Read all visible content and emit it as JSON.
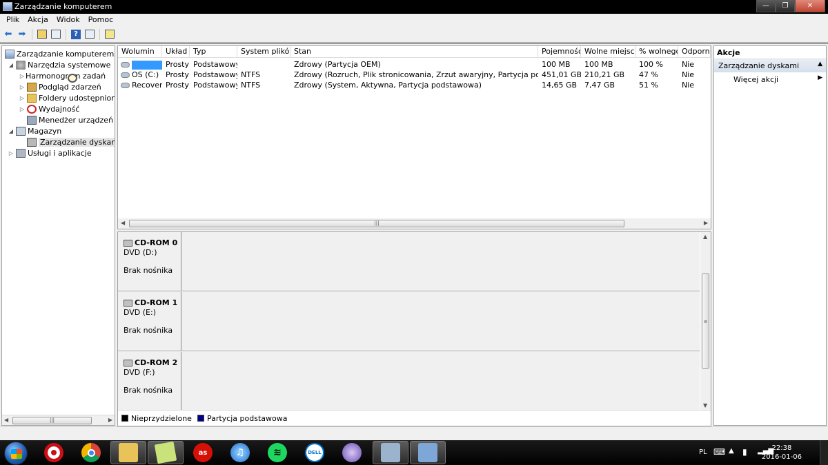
{
  "window": {
    "title": "Zarządzanie komputerem"
  },
  "menu": [
    "Plik",
    "Akcja",
    "Widok",
    "Pomoc"
  ],
  "tree": {
    "root": "Zarządzanie komputerem (lokal",
    "system_tools": "Narzędzia systemowe",
    "task_scheduler": "Harmonogram zadań",
    "event_viewer": "Podgląd zdarzeń",
    "shared_folders": "Foldery udostępnione",
    "performance": "Wydajność",
    "device_manager": "Menedżer urządzeń",
    "storage": "Magazyn",
    "disk_management": "Zarządzanie dyskami",
    "services_apps": "Usługi i aplikacje"
  },
  "volume_table": {
    "columns": [
      "Wolumin",
      "Układ",
      "Typ",
      "System plików",
      "Stan",
      "Pojemność",
      "Wolne miejsce",
      "% wolnego",
      "Odporno"
    ],
    "rows": [
      {
        "volume": "",
        "layout": "Prosty",
        "type": "Podstawowy",
        "fs": "",
        "status": "Zdrowy (Partycja OEM)",
        "capacity": "100 MB",
        "free": "100 MB",
        "pct": "100 %",
        "fault": "Nie"
      },
      {
        "volume": "OS (C:)",
        "layout": "Prosty",
        "type": "Podstawowy",
        "fs": "NTFS",
        "status": "Zdrowy (Rozruch, Plik stronicowania, Zrzut awaryjny, Partycja podstawowa)",
        "capacity": "451,01 GB",
        "free": "210,21 GB",
        "pct": "47 %",
        "fault": "Nie"
      },
      {
        "volume": "Recovery",
        "layout": "Prosty",
        "type": "Podstawowy",
        "fs": "NTFS",
        "status": "Zdrowy (System, Aktywna, Partycja podstawowa)",
        "capacity": "14,65 GB",
        "free": "7,47 GB",
        "pct": "51 %",
        "fault": "Nie"
      }
    ]
  },
  "disks": [
    {
      "name": "CD-ROM 0",
      "type": "DVD (D:)",
      "status": "Brak nośnika"
    },
    {
      "name": "CD-ROM 1",
      "type": "DVD (E:)",
      "status": "Brak nośnika"
    },
    {
      "name": "CD-ROM 2",
      "type": "DVD (F:)",
      "status": "Brak nośnika"
    }
  ],
  "legend": [
    {
      "label": "Nieprzydzielone",
      "color": "#000000"
    },
    {
      "label": "Partycja podstawowa",
      "color": "#00008b"
    }
  ],
  "actions": {
    "header": "Akcje",
    "group": "Zarządzanie dyskami",
    "more": "Więcej akcji"
  },
  "taskbar": {
    "apps": [
      "opera",
      "chrome",
      "explorer",
      "notes",
      "lastfm",
      "itunes",
      "spotify",
      "dell",
      "torrent",
      "remote",
      "computer-management"
    ],
    "lastfm_label": "as",
    "dell_label": "DELL",
    "language": "PL",
    "time": "22:38",
    "date": "2016-01-06"
  },
  "colors": {
    "selection": "#3399ff",
    "titlebar": "#000000",
    "chrome": "#f0f0f0"
  }
}
